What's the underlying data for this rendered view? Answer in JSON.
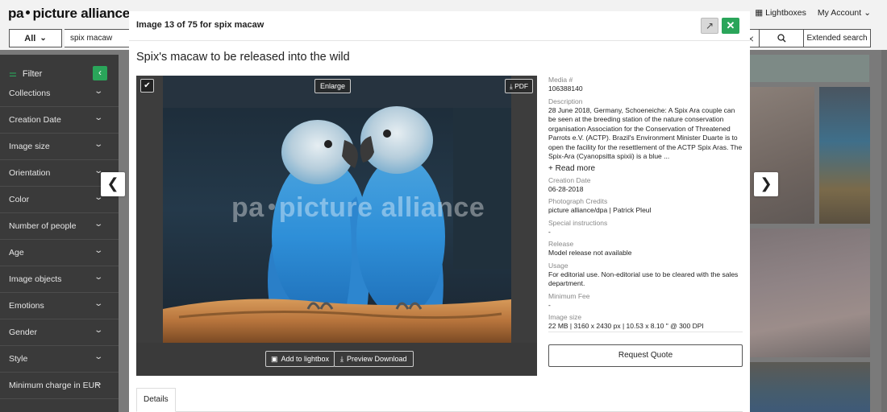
{
  "header": {
    "logo": "picture alliance",
    "logo_prefix": "pa",
    "lightboxes": "Lightboxes",
    "my_account": "My Account"
  },
  "search": {
    "scope": "All",
    "query": "spix macaw",
    "extended": "Extended search"
  },
  "sidebar": {
    "filter_label": "Filter",
    "items": [
      "Collections",
      "Creation Date",
      "Image size",
      "Orientation",
      "Color",
      "Number of people",
      "Age",
      "Image objects",
      "Emotions",
      "Gender",
      "Style",
      "Minimum charge in EUR"
    ]
  },
  "modal": {
    "counter": "Image 13 of 75  for spix macaw",
    "title": "Spix's macaw to be released into the wild",
    "enlarge": "Enlarge",
    "pdf": "PDF",
    "watermark": "picture alliance",
    "watermark_prefix": "pa",
    "add_to_lightbox": "Add to lightbox",
    "preview_download": "Preview Download",
    "request_quote": "Request Quote",
    "tab_details": "Details",
    "meta": {
      "media_label": "Media #",
      "media_value": "106388140",
      "description_label": "Description",
      "description_value": "28 June 2018, Germany, Schoeneiche: A Spix Ara couple can be seen at the breeding station of the nature conservation organisation Association for the Conservation of Threatened Parrots e.V. (ACTP). Brazil's Environment Minister Duarte is to open the facility for the resettlement of the ACTP Spix Aras. The Spix-Ara (Cyanopsitta spixii) is a blue ...",
      "read_more": "+ Read more",
      "creation_label": "Creation Date",
      "creation_value": "06-28-2018",
      "credits_label": "Photograph Credits",
      "credits_value": "picture alliance/dpa | Patrick Pleul",
      "special_label": "Special instructions",
      "special_value": "-",
      "release_label": "Release",
      "release_value": "Model release not available",
      "usage_label": "Usage",
      "usage_value": "For editorial use. Non-editorial use to be cleared with the sales department.",
      "fee_label": "Minimum Fee",
      "fee_value": "-",
      "size_label": "Image size",
      "size_value": "22 MB |  3160 x 2430 px |  10.53 x 8.10 \" @ 300 DPI"
    }
  },
  "colors": {
    "accent_green": "#2aa55a",
    "sidebar_bg": "#3a3a3a",
    "macaw_blue": "#2e8fd8"
  }
}
